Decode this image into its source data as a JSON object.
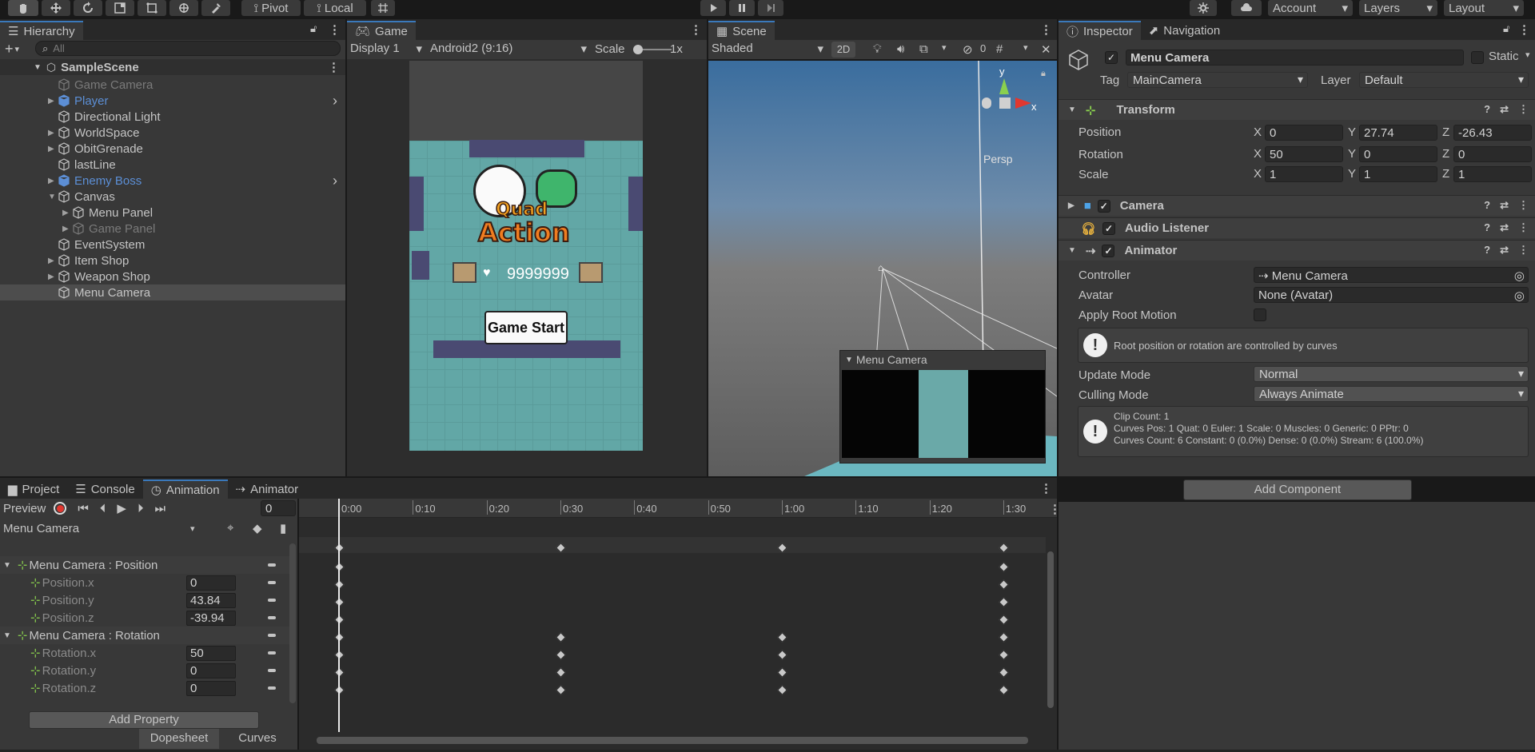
{
  "toolbar": {
    "pivot_label": "Pivot",
    "local_label": "Local",
    "account_label": "Account",
    "layers_label": "Layers",
    "layout_label": "Layout",
    "tool_icons": [
      "hand-tool-icon",
      "move-tool-icon",
      "rotate-tool-icon",
      "scale-tool-icon",
      "rect-tool-icon",
      "transform-tool-icon",
      "custom-tool-icon"
    ],
    "play_icon": "play-icon",
    "pause_icon": "pause-icon",
    "step_icon": "step-icon"
  },
  "hierarchy": {
    "tab_label": "Hierarchy",
    "search_placeholder": "All",
    "scene_name": "SampleScene",
    "items": [
      {
        "label": "Game Camera",
        "indent": 1,
        "state": "dim",
        "arrow": ""
      },
      {
        "label": "Player",
        "indent": 1,
        "state": "prefab",
        "arrow": "▶"
      },
      {
        "label": "Directional Light",
        "indent": 1,
        "state": "normal",
        "arrow": ""
      },
      {
        "label": "WorldSpace",
        "indent": 1,
        "state": "normal",
        "arrow": "▶"
      },
      {
        "label": "ObitGrenade",
        "indent": 1,
        "state": "normal",
        "arrow": "▶"
      },
      {
        "label": "lastLine",
        "indent": 1,
        "state": "normal",
        "arrow": ""
      },
      {
        "label": "Enemy Boss",
        "indent": 1,
        "state": "prefab",
        "arrow": "▶"
      },
      {
        "label": "Canvas",
        "indent": 1,
        "state": "normal",
        "arrow": "▼"
      },
      {
        "label": "Menu Panel",
        "indent": 2,
        "state": "normal",
        "arrow": "▶"
      },
      {
        "label": "Game Panel",
        "indent": 2,
        "state": "dim",
        "arrow": "▶"
      },
      {
        "label": "EventSystem",
        "indent": 1,
        "state": "normal",
        "arrow": ""
      },
      {
        "label": "Item Shop",
        "indent": 1,
        "state": "normal",
        "arrow": "▶"
      },
      {
        "label": "Weapon Shop",
        "indent": 1,
        "state": "normal",
        "arrow": "▶"
      },
      {
        "label": "Menu Camera",
        "indent": 1,
        "state": "selected",
        "arrow": ""
      }
    ]
  },
  "game": {
    "tab_label": "Game",
    "display_label": "Display 1",
    "resolution_label": "Android2 (9:16)",
    "scale_label": "Scale",
    "scale_value": "1x",
    "logo_line1": "Quad",
    "logo_line2": "Action",
    "score_text": "9999999",
    "start_button": "Game Start"
  },
  "scene": {
    "tab_label": "Scene",
    "shading_label": "Shaded",
    "mode_2d": "2D",
    "hidden_count": "0",
    "gizmo_y": "y",
    "gizmo_x": "x",
    "persp_label": "Persp",
    "camera_preview_title": "Menu Camera"
  },
  "inspector": {
    "tab_label": "Inspector",
    "nav_tab_label": "Navigation",
    "object_name": "Menu Camera",
    "static_label": "Static",
    "tag_label": "Tag",
    "tag_value": "MainCamera",
    "layer_label": "Layer",
    "layer_value": "Default",
    "transform": {
      "title": "Transform",
      "position_label": "Position",
      "position": {
        "x": "0",
        "y": "27.74",
        "z": "-26.43"
      },
      "rotation_label": "Rotation",
      "rotation": {
        "x": "50",
        "y": "0",
        "z": "0"
      },
      "scale_label": "Scale",
      "scale": {
        "x": "1",
        "y": "1",
        "z": "1"
      },
      "axis_x": "X",
      "axis_y": "Y",
      "axis_z": "Z"
    },
    "camera_title": "Camera",
    "audio_title": "Audio Listener",
    "animator": {
      "title": "Animator",
      "controller_label": "Controller",
      "controller_value": "Menu Camera",
      "avatar_label": "Avatar",
      "avatar_value": "None (Avatar)",
      "root_motion_label": "Apply Root Motion",
      "root_motion_info": "Root position or rotation are controlled by curves",
      "update_mode_label": "Update Mode",
      "update_mode_value": "Normal",
      "culling_mode_label": "Culling Mode",
      "culling_mode_value": "Always Animate",
      "clip_info_1": "Clip Count: 1",
      "clip_info_2": "Curves Pos: 1 Quat: 0 Euler: 1 Scale: 0 Muscles: 0 Generic: 0 PPtr: 0",
      "clip_info_3": "Curves Count: 6 Constant: 0 (0.0%) Dense: 0 (0.0%) Stream: 6 (100.0%)"
    },
    "add_component": "Add Component"
  },
  "bottom_tabs": [
    "Project",
    "Console",
    "Animation",
    "Animator"
  ],
  "animation": {
    "preview_label": "Preview",
    "frame_value": "0",
    "clip_name": "Menu Camera",
    "groups": [
      {
        "label": "Menu Camera : Position",
        "props": [
          {
            "label": "Position.x",
            "value": "0"
          },
          {
            "label": "Position.y",
            "value": "43.84"
          },
          {
            "label": "Position.z",
            "value": "-39.94"
          }
        ]
      },
      {
        "label": "Menu Camera : Rotation",
        "props": [
          {
            "label": "Rotation.x",
            "value": "50"
          },
          {
            "label": "Rotation.y",
            "value": "0"
          },
          {
            "label": "Rotation.z",
            "value": "0"
          }
        ]
      }
    ],
    "add_property": "Add Property",
    "dopesheet_label": "Dopesheet",
    "curves_label": "Curves",
    "ruler": [
      "0:00",
      "0:10",
      "0:20",
      "0:30",
      "0:40",
      "0:50",
      "1:00",
      "1:10",
      "1:20",
      "1:30"
    ]
  }
}
